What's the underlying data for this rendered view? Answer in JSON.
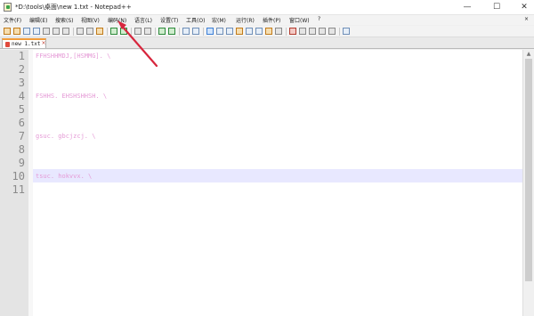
{
  "window": {
    "title": "*D:\\tools\\桌面\\new 1.txt - Notepad++",
    "minimize_glyph": "—",
    "maximize_glyph": "☐",
    "close_glyph": "✕"
  },
  "menu": {
    "items": [
      "文件(F)",
      "编辑(E)",
      "搜索(S)",
      "视图(V)",
      "编码(N)",
      "语言(L)",
      "设置(T)",
      "工具(O)",
      "宏(M)",
      "运行(R)",
      "插件(P)",
      "窗口(W)",
      "?"
    ],
    "close_glyph": "×"
  },
  "toolbar": {
    "icons": [
      "new-file-icon",
      "open-file-icon",
      "save-icon",
      "save-all-icon",
      "close-icon",
      "close-all-icon",
      "print-icon",
      "cut-icon",
      "copy-icon",
      "paste-icon",
      "undo-icon",
      "redo-icon",
      "find-icon",
      "replace-icon",
      "zoom-in-icon",
      "zoom-out-icon",
      "sync-vertical-icon",
      "sync-horizontal-icon",
      "word-wrap-icon",
      "show-all-chars-icon",
      "indent-guide-icon",
      "user-language-icon",
      "doc-map-icon",
      "function-list-icon",
      "folder-workspace-icon",
      "monitoring-icon",
      "record-macro-icon",
      "stop-record-icon",
      "play-macro-icon",
      "play-multiple-icon",
      "save-macro-icon",
      "spell-check-icon"
    ]
  },
  "tab": {
    "label": "new 1.txt",
    "close_glyph": "×"
  },
  "editor": {
    "line_numbers": [
      "1",
      "2",
      "3",
      "4",
      "5",
      "6",
      "7",
      "8",
      "9",
      "10",
      "11"
    ],
    "lines": [
      "FFHSHHMDJ,[HSMMG]. \\",
      "",
      "",
      "FSHHS. EHSHSHHSH. \\",
      "",
      "",
      "gsuc. gbcjzcj. \\",
      "",
      "",
      "tsuc. hokvvx. \\",
      ""
    ],
    "current_line": 10
  },
  "colors": {
    "code_text": "#e59ad6",
    "current_line_bg": "#e8e8ff",
    "annotation_arrow": "#d7263d"
  }
}
